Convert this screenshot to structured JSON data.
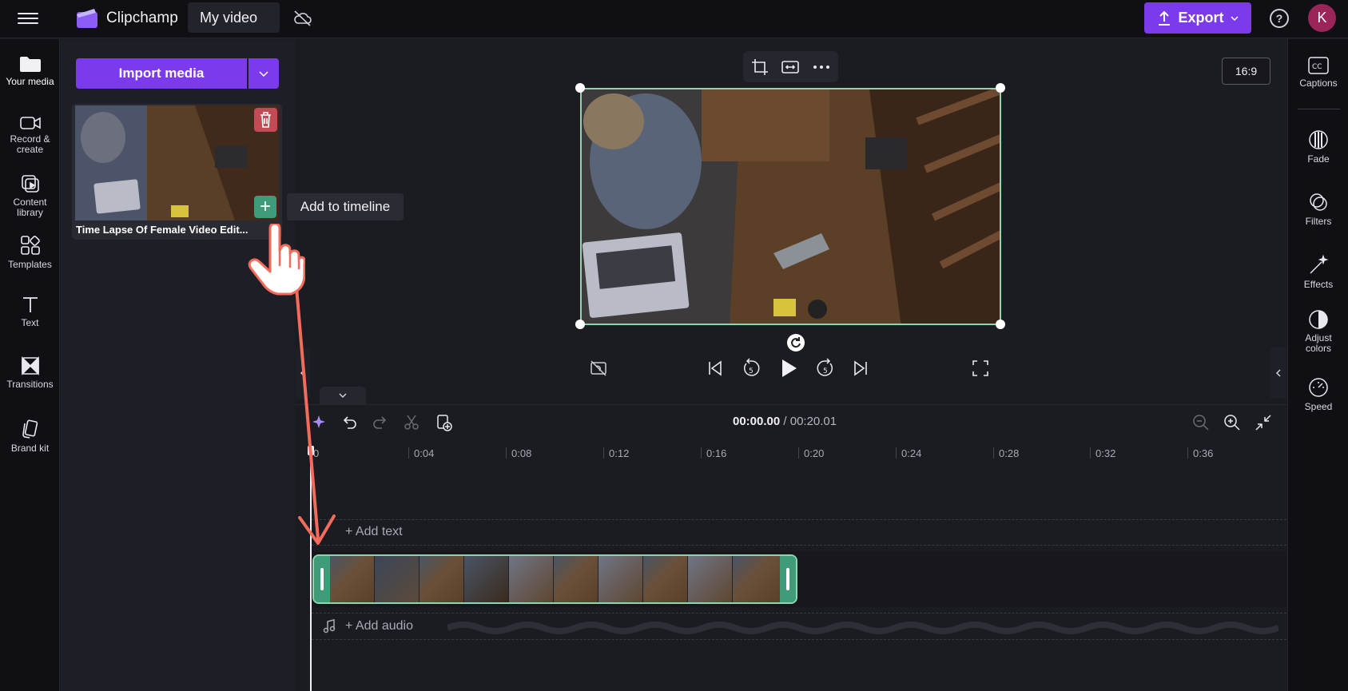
{
  "topbar": {
    "brand": "Clipchamp",
    "project_title": "My video",
    "export_label": "Export",
    "help_label": "?",
    "avatar_initial": "K"
  },
  "leftnav": {
    "items": [
      {
        "label": "Your media",
        "icon": "folder-icon",
        "active": true
      },
      {
        "label": "Record & create",
        "icon": "camera-icon"
      },
      {
        "label": "Content library",
        "icon": "library-icon"
      },
      {
        "label": "Templates",
        "icon": "templates-icon"
      },
      {
        "label": "Text",
        "icon": "text-icon"
      },
      {
        "label": "Transitions",
        "icon": "transitions-icon"
      },
      {
        "label": "Brand kit",
        "icon": "brand-kit-icon"
      }
    ]
  },
  "media": {
    "import_label": "Import media",
    "items": [
      {
        "name": "Time Lapse Of Female Video Edit..."
      }
    ],
    "add_tooltip": "Add to timeline"
  },
  "preview": {
    "aspect_ratio": "16:9"
  },
  "timeline": {
    "current_time": "00:00.00",
    "total_time": "/ 00:20.01",
    "ticks": [
      "0",
      "0:04",
      "0:08",
      "0:12",
      "0:16",
      "0:20",
      "0:24",
      "0:28",
      "0:32",
      "0:36"
    ],
    "add_text_label": "+ Add text",
    "add_audio_label": "+ Add audio"
  },
  "rightnav": {
    "items": [
      {
        "label": "Captions",
        "icon": "captions-icon"
      },
      {
        "label": "Fade",
        "icon": "fade-icon"
      },
      {
        "label": "Filters",
        "icon": "filters-icon"
      },
      {
        "label": "Effects",
        "icon": "effects-icon"
      },
      {
        "label": "Adjust colors",
        "icon": "adjust-colors-icon"
      },
      {
        "label": "Speed",
        "icon": "speed-icon"
      }
    ]
  },
  "colors": {
    "accent": "#7c3aed",
    "selection": "#8fd6b0",
    "add_green": "#3f9b78",
    "delete_red": "#c24b56",
    "arrow": "#f26b5b"
  }
}
